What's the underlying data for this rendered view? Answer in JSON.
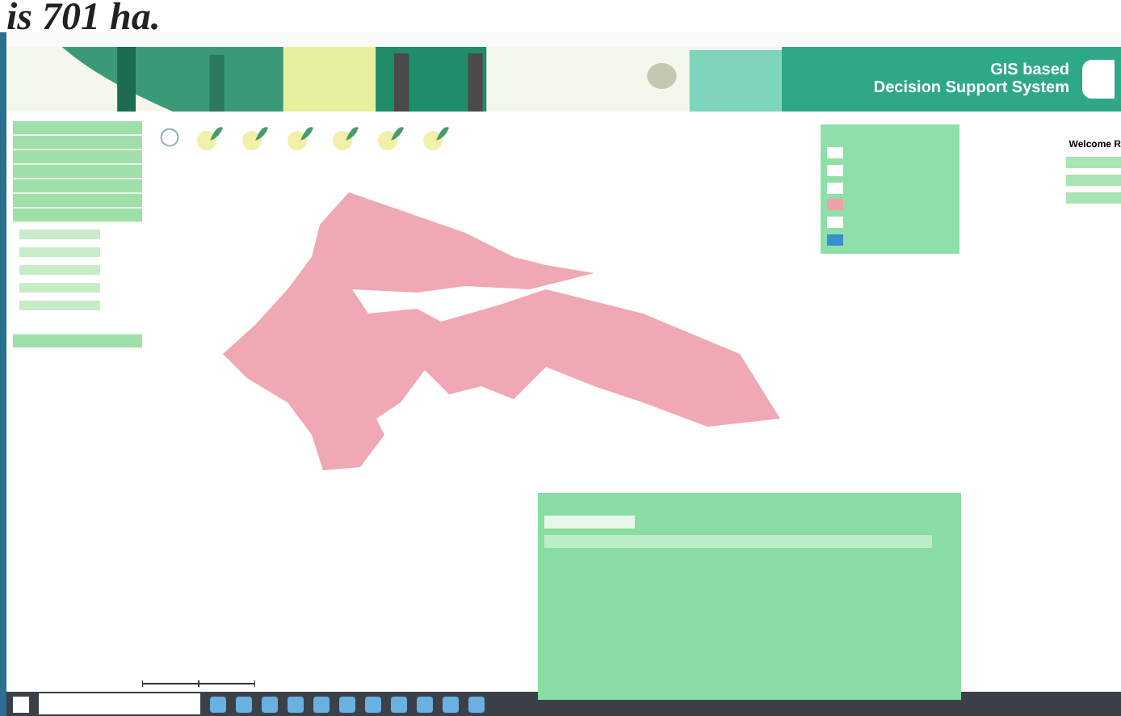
{
  "page_text": "is 701 ha.",
  "banner": {
    "title_line_1": "GIS based",
    "title_line_2": "Decision Support System"
  },
  "user": {
    "greeting": "Welcome R"
  }
}
